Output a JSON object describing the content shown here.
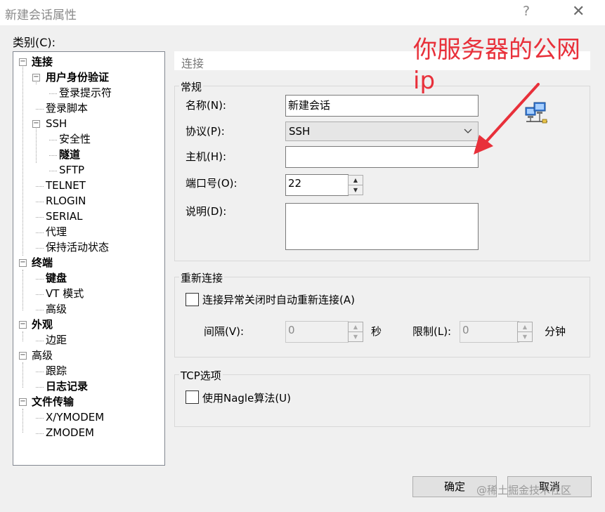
{
  "window": {
    "title": "新建会话属性",
    "help_glyph": "?",
    "close_glyph": "✕"
  },
  "category_label": "类别(C):",
  "tree": [
    {
      "label": "连接",
      "bold": true,
      "expander": "−"
    },
    {
      "label": "用户身份验证",
      "bold": true,
      "expander": "−"
    },
    {
      "label": "登录提示符",
      "bold": false
    },
    {
      "label": "登录脚本",
      "bold": false
    },
    {
      "label": "SSH",
      "bold": false,
      "expander": "−"
    },
    {
      "label": "安全性",
      "bold": false
    },
    {
      "label": "隧道",
      "bold": true
    },
    {
      "label": "SFTP",
      "bold": false
    },
    {
      "label": "TELNET",
      "bold": false
    },
    {
      "label": "RLOGIN",
      "bold": false
    },
    {
      "label": "SERIAL",
      "bold": false
    },
    {
      "label": "代理",
      "bold": false
    },
    {
      "label": "保持活动状态",
      "bold": false
    },
    {
      "label": "终端",
      "bold": true,
      "expander": "−"
    },
    {
      "label": "键盘",
      "bold": true
    },
    {
      "label": "VT 模式",
      "bold": false
    },
    {
      "label": "高级",
      "bold": false
    },
    {
      "label": "外观",
      "bold": true,
      "expander": "−"
    },
    {
      "label": "边距",
      "bold": false
    },
    {
      "label": "高级",
      "bold": false,
      "expander": "−"
    },
    {
      "label": "跟踪",
      "bold": false
    },
    {
      "label": "日志记录",
      "bold": true
    },
    {
      "label": "文件传输",
      "bold": true,
      "expander": "−"
    },
    {
      "label": "X/YMODEM",
      "bold": false
    },
    {
      "label": "ZMODEM",
      "bold": false
    }
  ],
  "section_title": "连接",
  "general": {
    "title": "常规",
    "name_label": "名称(N):",
    "name_value": "新建会话",
    "protocol_label": "协议(P):",
    "protocol_value": "SSH",
    "host_label": "主机(H):",
    "host_value": "",
    "port_label": "端口号(O):",
    "port_value": "22",
    "desc_label": "说明(D):",
    "desc_value": ""
  },
  "reconnect": {
    "title": "重新连接",
    "checkbox_label": "连接异常关闭时自动重新连接(A)",
    "checked": false,
    "interval_label": "间隔(V):",
    "interval_value": "0",
    "interval_unit": "秒",
    "limit_label": "限制(L):",
    "limit_value": "0",
    "limit_unit": "分钟"
  },
  "tcp": {
    "title": "TCP选项",
    "nagle_label": "使用Nagle算法(U)",
    "checked": false
  },
  "buttons": {
    "ok": "确定",
    "cancel": "取消"
  },
  "annotation": {
    "line1": "你服务器的公网",
    "line2": "ip",
    "color": "#e8303a"
  },
  "watermark": "@稀土掘金技术社区",
  "icons": {
    "network": "network-computers-icon",
    "arrow": "red-arrow-annotation"
  }
}
